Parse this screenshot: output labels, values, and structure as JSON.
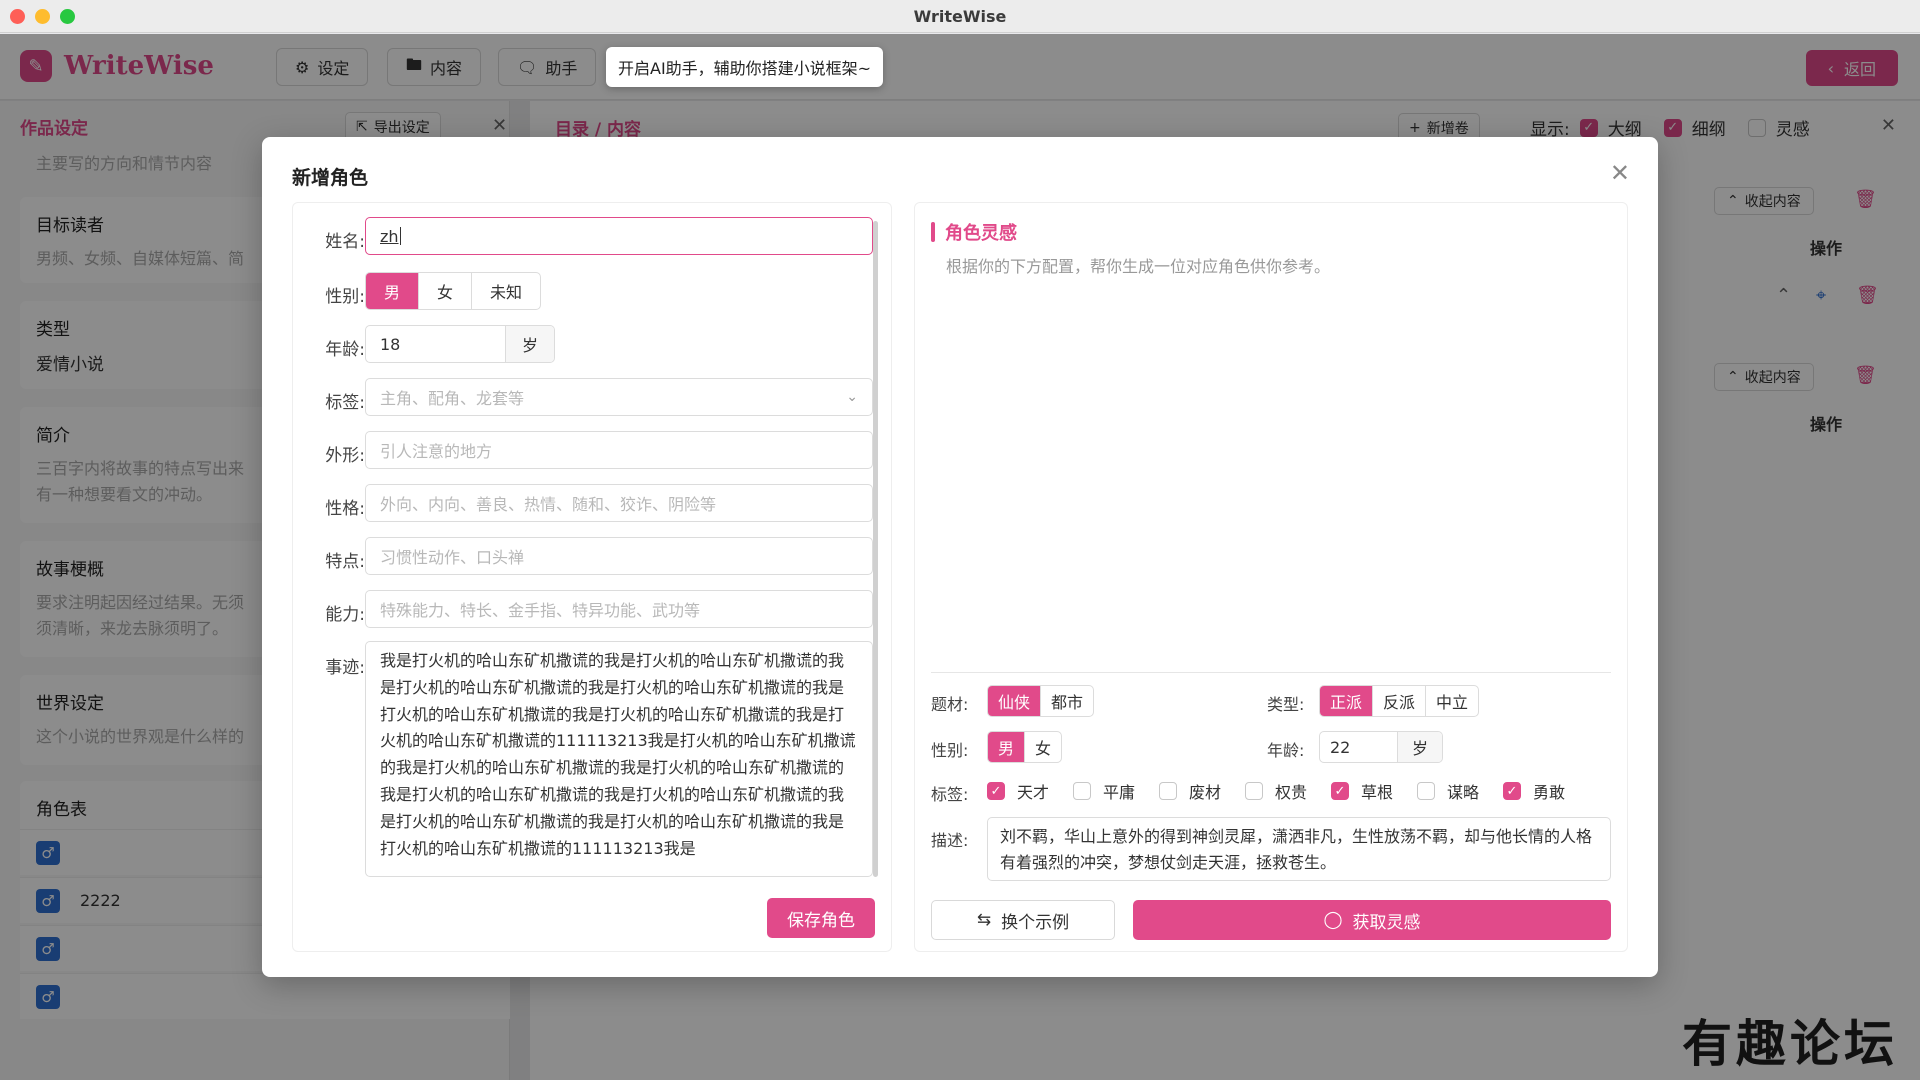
{
  "window": {
    "title": "WriteWise"
  },
  "header": {
    "logo_text": "WriteWise",
    "buttons": [
      {
        "label": "设定",
        "icon": "gear-icon"
      },
      {
        "label": "内容",
        "icon": "folder-icon"
      },
      {
        "label": "助手",
        "icon": "chat-icon"
      }
    ],
    "tooltip": "开启AI助手，辅助你搭建小说框架~",
    "back_label": "返回"
  },
  "left_panel": {
    "title": "作品设定",
    "export_label": "导出设定",
    "direction_placeholder": "主要写的方向和情节内容",
    "target_readers": {
      "label": "目标读者",
      "hint": "男频、女频、自媒体短篇、简"
    },
    "genre": {
      "label": "类型",
      "value": "爱情小说"
    },
    "intro": {
      "label": "简介",
      "hint_line1": "三百字内将故事的特点写出来",
      "hint_line2": "有一种想要看文的冲动。"
    },
    "synopsis": {
      "label": "故事梗概",
      "hint_line1": "要求注明起因经过结果。无须",
      "hint_line2": "须清晰，来龙去脉须明了。"
    },
    "world": {
      "label": "世界设定",
      "hint": "这个小说的世界观是什么样的"
    },
    "roles": {
      "label": "角色表",
      "items": [
        "",
        "2222",
        "",
        ""
      ]
    }
  },
  "right_panel": {
    "breadcrumb": "目录 / 内容",
    "new_volume_label": "新增卷",
    "show_label": "显示:",
    "show_options": [
      {
        "label": "大纲",
        "checked": true
      },
      {
        "label": "细纲",
        "checked": true
      },
      {
        "label": "灵感",
        "checked": false
      }
    ],
    "collapse_label": "收起内容",
    "operation_label": "操作"
  },
  "modal": {
    "title": "新增角色",
    "form": {
      "name": {
        "label": "姓名:",
        "value": "zh"
      },
      "gender": {
        "label": "性别:",
        "options": [
          "男",
          "女",
          "未知"
        ],
        "selected": "男"
      },
      "age": {
        "label": "年龄:",
        "value": "18",
        "unit": "岁"
      },
      "tags": {
        "label": "标签:",
        "placeholder": "主角、配角、龙套等"
      },
      "appearance": {
        "label": "外形:",
        "placeholder": "引人注意的地方"
      },
      "personality": {
        "label": "性格:",
        "placeholder": "外向、内向、善良、热情、随和、狡诈、阴险等"
      },
      "traits": {
        "label": "特点:",
        "placeholder": "习惯性动作、口头禅"
      },
      "ability": {
        "label": "能力:",
        "placeholder": "特殊能力、特长、金手指、特异功能、武功等"
      },
      "story": {
        "label": "事迹:",
        "value": "我是打火机的哈山东矿机撒谎的我是打火机的哈山东矿机撒谎的我是打火机的哈山东矿机撒谎的我是打火机的哈山东矿机撒谎的我是打火机的哈山东矿机撒谎的我是打火机的哈山东矿机撒谎的我是打火机的哈山东矿机撒谎的111113213我是打火机的哈山东矿机撒谎的我是打火机的哈山东矿机撒谎的我是打火机的哈山东矿机撒谎的我是打火机的哈山东矿机撒谎的我是打火机的哈山东矿机撒谎的我是打火机的哈山东矿机撒谎的我是打火机的哈山东矿机撒谎的我是打火机的哈山东矿机撒谎的111113213我是"
      },
      "save_label": "保存角色"
    },
    "inspiration": {
      "title": "角色灵感",
      "desc": "根据你的下方配置，帮你生成一位对应角色供你参考。",
      "theme": {
        "label": "题材:",
        "options": [
          "仙侠",
          "都市"
        ],
        "selected": "仙侠"
      },
      "type": {
        "label": "类型:",
        "options": [
          "正派",
          "反派",
          "中立"
        ],
        "selected": "正派"
      },
      "gender": {
        "label": "性别:",
        "options": [
          "男",
          "女"
        ],
        "selected": "男"
      },
      "age": {
        "label": "年龄:",
        "value": "22",
        "unit": "岁"
      },
      "tags": {
        "label": "标签:",
        "items": [
          {
            "label": "天才",
            "checked": true
          },
          {
            "label": "平庸",
            "checked": false
          },
          {
            "label": "废材",
            "checked": false
          },
          {
            "label": "权贵",
            "checked": false
          },
          {
            "label": "草根",
            "checked": true
          },
          {
            "label": "谋略",
            "checked": false
          },
          {
            "label": "勇敢",
            "checked": true
          }
        ]
      },
      "description": {
        "label": "描述:",
        "value": "刘不羁，华山上意外的得到神剑灵犀，潇洒非凡，生性放荡不羁，却与他长情的人格有着强烈的冲突，梦想仗剑走天涯，拯救苍生。"
      },
      "swap_label": "换个示例",
      "get_label": "获取灵感"
    }
  },
  "watermark": "有趣论坛",
  "colors": {
    "accent": "#e14a8a",
    "role_icon": "#2f6fd1"
  }
}
